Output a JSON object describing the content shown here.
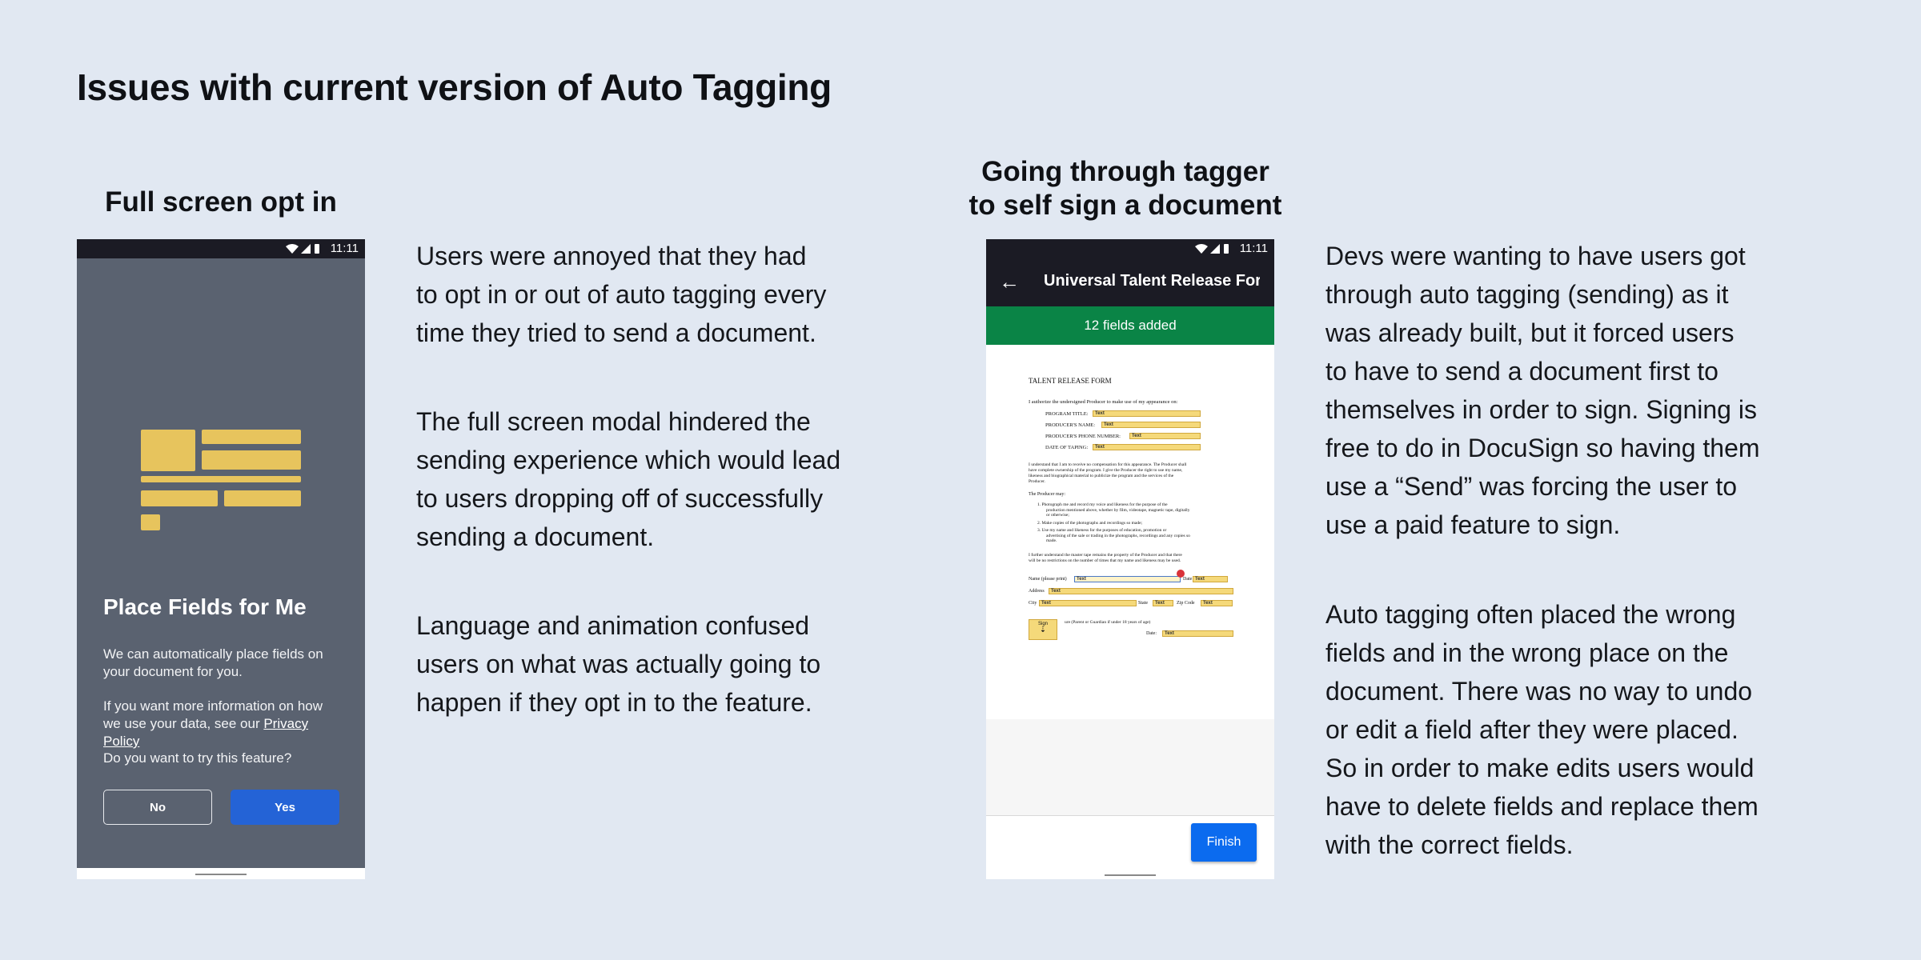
{
  "page": {
    "title": "Issues with current version of Auto Tagging"
  },
  "sections": {
    "left": {
      "heading": "Full screen opt in",
      "paragraphs": [
        [
          "Users were annoyed that they had",
          "to opt in or out of auto tagging every",
          "time they tried to send a document."
        ],
        [
          "The full screen modal hindered the",
          "sending experience which would lead",
          "to users dropping off of successfully",
          "sending a document."
        ],
        [
          "Language and animation confused",
          "users on what was actually going to",
          "happen if they opt in to the feature."
        ]
      ]
    },
    "right": {
      "heading_line1": "Going through tagger",
      "heading_line2": "to self sign a document",
      "paragraphs": [
        [
          "Devs were wanting to have users got",
          "through auto tagging (sending) as it",
          "was already built, but it forced users",
          "to have to send a document first to",
          "themselves in order to sign. Signing is",
          "free to do in DocuSign so having them",
          "use a “Send” was forcing the user to",
          "use a paid feature to sign."
        ],
        [
          "Auto tagging often placed the wrong",
          "fields and in the wrong place on the",
          "document. There was no way to undo",
          "or edit a field after they were placed.",
          "So in order to make edits users would",
          "have to delete fields and replace them",
          "with the correct fields."
        ]
      ]
    }
  },
  "phone1": {
    "status_time": "11:11",
    "title": "Place Fields for Me",
    "text1": "We can automatically place fields on your document for you.",
    "text2_prefix": "If you want more information on how we use your data, see our ",
    "text2_link": "Privacy Policy",
    "text3": "Do you want to try this feature?",
    "no_label": "No",
    "yes_label": "Yes",
    "colors": {
      "screen": "#5a6270",
      "accent_yellow": "#e7c45d",
      "yes_button": "#2463d6"
    }
  },
  "phone2": {
    "status_time": "11:11",
    "doc_title": "Universal Talent Release For...",
    "banner": "12 fields added",
    "finish_label": "Finish",
    "colors": {
      "banner": "#0a8446",
      "finish": "#0b6bef"
    },
    "doc": {
      "heading": "TALENT RELEASE FORM",
      "intro": "I authorize the undersigned Producer to make use of my appearance on:",
      "fields": [
        "PROGRAM TITLE:",
        "PRODUCER'S NAME:",
        "PRODUCER'S PHONE NUMBER:",
        "DATE OF TAPING:"
      ],
      "p1": "I understand that I am to receive no compensation for this appearance. The Producer shall",
      "p1b": "have complete ownership of the program. I give the Producer the right to use my name,",
      "p1c": "likeness and biographical material to publicize the program and the services of the",
      "p1d": "Producer.",
      "may": "The Producer may:",
      "li1": "1.  Photograph me and record my voice and likeness for the purpose of the",
      "li1b": "production mentioned above, whether by film, videotape, magnetic tape, digitally",
      "li1c": "or otherwise;",
      "li2": "2.  Make copies of the photographs and recordings so made;",
      "li3": "3.  Use my name and likeness for the purposes of education, promotion or",
      "li3b": "advertising of the sale or trading in the photographs, recordings and any copies so",
      "li3c": "made.",
      "p2": "I further understand the master tape remains the property of the Producer and that there",
      "p2b": "will be no restrictions on the number of times that my name and likeness may be used.",
      "name": "Name (please print)",
      "date": "Date",
      "address": "Address",
      "city": "City",
      "state": "State",
      "zip": "Zip Code",
      "guardian": "ure (Parent or Guardian if under 18 years of age)",
      "date2": "Date:",
      "tag_text": "Text",
      "sign": "Sign"
    }
  }
}
